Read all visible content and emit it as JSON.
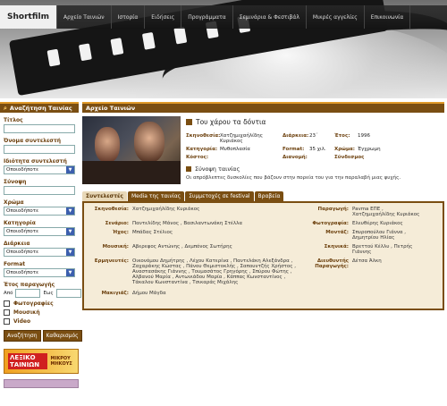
{
  "header": {
    "logo": "Shortfilm",
    "nav": [
      "Αρχείο Ταινιών",
      "Ιστορία",
      "Ειδήσεις",
      "Προγράμματα",
      "Σεμινάρια & Φεστιβάλ",
      "Μικρές αγγελίες",
      "Επικοινωνία"
    ]
  },
  "sidebar": {
    "title": "Αναζήτηση Ταινίας",
    "fields": {
      "title_label": "Τίτλος",
      "creator_label": "Όνομα συντελεστή",
      "role_label": "Ιδιότητα συντελεστή",
      "synopsis_label": "Σύνοψη",
      "color_label": "Χρώμα",
      "category_label": "Κατηγορία",
      "duration_label": "Διάρκεια",
      "format_label": "Format",
      "year_label": "Έτος παραγωγής",
      "year_from": "Από",
      "year_to": "Εως",
      "select_default": "Οποιοδήποτε"
    },
    "checks": [
      "Φωτογραφίες",
      "Μουσική",
      "Video"
    ],
    "buttons": {
      "search": "Αναζήτηση",
      "clear": "Καθαρισμός"
    },
    "banner": {
      "main": "ΛΕΞΙΚΟ ΤΑΙΝΙΩΝ",
      "sub": "ΜΙΚΡΟΥ ΜΗΚΟΥΣ"
    }
  },
  "main": {
    "section_title": "Αρχείο Ταινιών",
    "movie_title": "Του χάρου τα δόντια",
    "info": {
      "director_k": "Σκηνοθεσία:",
      "director_v": "Χατζημιχαήλίδης Κυριάκος",
      "duration_k": "Διάρκεια:",
      "duration_v": "23΄",
      "year_k": "Έτος:",
      "year_v": "1996",
      "category_k": "Κατηγορία:",
      "category_v": "Μυθοπλασία",
      "format_k": "Format:",
      "format_v": "35 χιλ.",
      "color_k": "Χρώμα:",
      "color_v": "Έγχρωμη",
      "cost_k": "Κόστος:",
      "cost_v": "",
      "distribution_k": "Διανομή:",
      "distribution_v": "",
      "sound_k": "Σύνδεσμος",
      "sound_v": ""
    },
    "synopsis_title": "Σύνοψη ταινίας",
    "synopsis_text": "Οι απρόβλεπτες δυσκολίες που βάζουν στην πορεία του για την παραλαβή μιας ψυχής.",
    "tabs": [
      "Συντελεστές",
      "Media της ταινίας",
      "Συμμετοχές σε festival",
      "Βραβεία"
    ],
    "credits": [
      {
        "k": "Σκηνοθεσία:",
        "v": "Χατζημιχαήλίδης Κυριάκος",
        "k2": "Παραγωγή:",
        "v2": "Pavma ΕΠΕ , Χατζημιχαήλίδης Κυριάκος"
      },
      {
        "k": "Σενάριο:",
        "v": "Παντελίδης Μάνος , Βασιλαντωνάκη Στέλλα",
        "k2": "Φωτογραφία:",
        "v2": "Ελευθέρης Κυριάκος"
      },
      {
        "k": "Ήχος:",
        "v": "Μπάδας Στέλιος",
        "k2": "Μοντάζ:",
        "v2": "Σπυροπούλου Γιάννα , Δημητρίου Ηλίας"
      },
      {
        "k": "Μουσική:",
        "v": "Αβερεφος Αντώνης , Δεμπόνος Σωτήρης",
        "k2": "Σκηνικά:",
        "v2": "Βρεττού Κέλλυ , Πετρής Γιάννης"
      },
      {
        "k": "Ερμηνευτές:",
        "v": "Οικονόμου Δημήτρης , Λέχου Κατερίνα , Παντελάκη Αλεξάνδρα , Ζαχαράκης Κώστας , Πάνου Θεμιστοκλής , Σαπουντζής Χρήστος , Αναστασάκης Γιάννης , Τουμασάτος Γρηγόρης , Σπύρου Φώτης , Αλβανού Μαρία , Αντωνιάδου Μαρία , Κάππας Κωνσταντίνος , Τάκαλου Κωνσταντίνα , Τσικαράς Μιχάλης",
        "k2": "Διευθυντής Παραγωγής:",
        "v2": "Δέτσα Άλκη"
      },
      {
        "k": "Μακιγιάζ:",
        "v": "Δήμου Μάγδα",
        "k2": "",
        "v2": ""
      }
    ]
  },
  "colors": {
    "accent": "#7a4e12",
    "accent_light": "#e09a2a",
    "panel": "#f5ecd8"
  }
}
